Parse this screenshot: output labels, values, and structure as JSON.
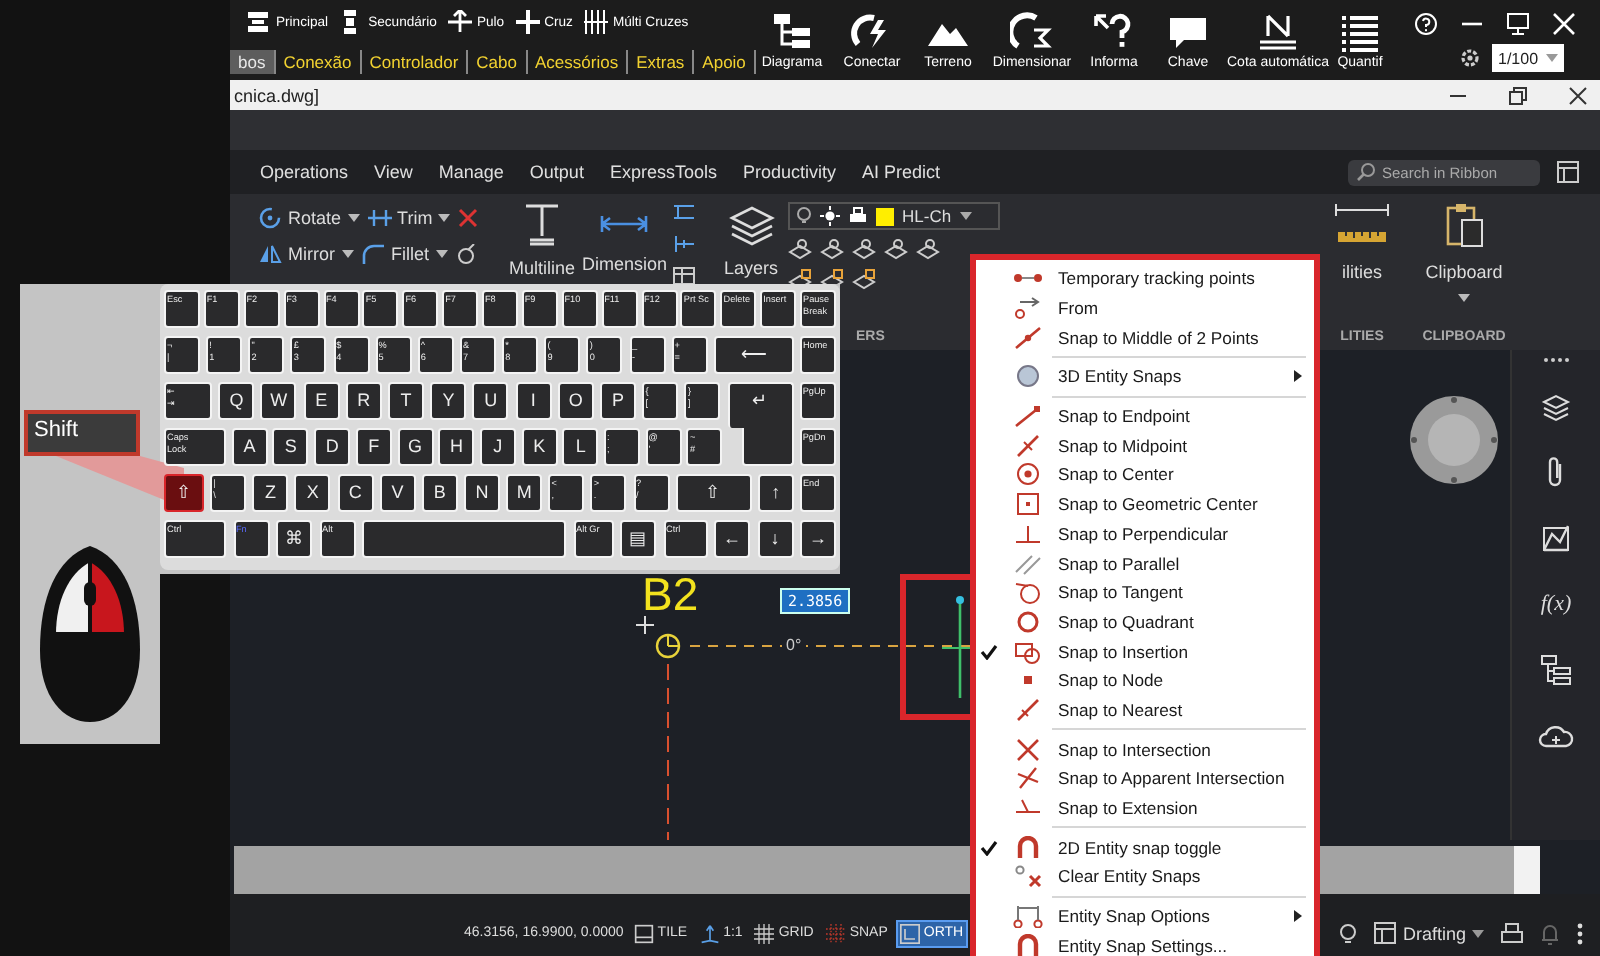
{
  "toolbar": {
    "buttons": [
      {
        "label": "Principal"
      },
      {
        "label": "Secundário"
      },
      {
        "label": "Pulo"
      },
      {
        "label": "Cruz"
      },
      {
        "label": "Múlti Cruzes"
      }
    ],
    "tabs": [
      {
        "label": "bos",
        "selected": true
      },
      {
        "label": "Conexão",
        "selected": false
      },
      {
        "label": "Controlador",
        "selected": false
      },
      {
        "label": "Cabo",
        "selected": false
      },
      {
        "label": "Acessórios",
        "selected": false
      },
      {
        "label": "Extras",
        "selected": false
      },
      {
        "label": "Apoio",
        "selected": false
      }
    ],
    "big_buttons": [
      {
        "label": "Diagrama"
      },
      {
        "label": "Conectar"
      },
      {
        "label": "Terreno"
      },
      {
        "label": "Dimensionar"
      },
      {
        "label": "Informa"
      },
      {
        "label": "Chave"
      },
      {
        "label": "Cota automática"
      },
      {
        "label": "Quantif"
      }
    ],
    "scale": {
      "value": "1/100"
    }
  },
  "document": {
    "title": "cnica.dwg]"
  },
  "ribbon": {
    "tabs": [
      {
        "label": "Operations",
        "selected": false
      },
      {
        "label": "View",
        "selected": false
      },
      {
        "label": "Manage",
        "selected": false
      },
      {
        "label": "Output",
        "selected": false
      },
      {
        "label": "ExpressTools",
        "selected": false
      },
      {
        "label": "Productivity",
        "selected": false
      },
      {
        "label": "AI Predict",
        "selected": false
      }
    ],
    "search": {
      "placeholder": "Search in Ribbon"
    },
    "modify_tools": [
      {
        "label": "Rotate"
      },
      {
        "label": "Trim"
      },
      {
        "label": "Mirror"
      },
      {
        "label": "Fillet"
      }
    ],
    "large_tools": [
      {
        "label": "Multiline"
      },
      {
        "label": "Dimension"
      },
      {
        "label": "Layers"
      }
    ],
    "layer": {
      "value": "HL-Ch"
    },
    "layers_panel": "ERS",
    "utilities_tool": "ilities",
    "utilities_panel": "LITIES",
    "clipboard_tool": "Clipboard",
    "clipboard_panel": "CLIPBOARD"
  },
  "overlay": {
    "callout": "Shift",
    "keyboard": {
      "rows": [
        {
          "keys": [
            {
              "label": "Esc",
              "kind": "key",
              "pressed": false
            },
            {
              "label": "F1",
              "kind": "key",
              "pressed": false
            },
            {
              "label": "F2",
              "kind": "key",
              "pressed": false
            },
            {
              "label": "F3",
              "kind": "key",
              "pressed": false
            },
            {
              "label": "F4",
              "kind": "key",
              "pressed": false
            },
            {
              "label": "F5",
              "kind": "key",
              "pressed": false
            },
            {
              "label": "F6",
              "kind": "key",
              "pressed": false
            },
            {
              "label": "F7",
              "kind": "key",
              "pressed": false
            },
            {
              "label": "F8",
              "kind": "key",
              "pressed": false
            },
            {
              "label": "F9",
              "kind": "key",
              "pressed": false
            },
            {
              "label": "F10",
              "kind": "key",
              "pressed": false
            },
            {
              "label": "F11",
              "kind": "key",
              "pressed": false
            },
            {
              "label": "F12",
              "kind": "key",
              "pressed": false
            },
            {
              "label": "Prt Sc",
              "kind": "key",
              "pressed": false
            },
            {
              "label": "Delete",
              "kind": "key",
              "pressed": false
            },
            {
              "label": "Insert",
              "kind": "key",
              "pressed": false
            },
            {
              "label": "Pause\nBreak",
              "kind": "key",
              "pressed": false
            }
          ]
        },
        {
          "keys": [
            {
              "label": "¬\n|",
              "kind": "key",
              "pressed": false
            },
            {
              "label": "!\n1",
              "kind": "key",
              "pressed": false
            },
            {
              "label": "\"\n2",
              "kind": "key",
              "pressed": false
            },
            {
              "label": "£\n3",
              "kind": "key",
              "pressed": false
            },
            {
              "label": "$\n4",
              "kind": "key",
              "pressed": false
            },
            {
              "label": "%\n5",
              "kind": "key",
              "pressed": false
            },
            {
              "label": "^\n6",
              "kind": "key",
              "pressed": false
            },
            {
              "label": "&\n7",
              "kind": "key",
              "pressed": false
            },
            {
              "label": "*\n8",
              "kind": "key",
              "pressed": false
            },
            {
              "label": "(\n9",
              "kind": "key",
              "pressed": false
            },
            {
              "label": ")\n0",
              "kind": "key",
              "pressed": false
            },
            {
              "label": "_\n-",
              "kind": "key",
              "pressed": false
            },
            {
              "label": "+\n=",
              "kind": "key",
              "pressed": false
            },
            {
              "label": "⟵",
              "kind": "backspace",
              "pressed": false
            },
            {
              "label": "Home",
              "kind": "key",
              "pressed": false
            }
          ]
        },
        {
          "keys": [
            {
              "label": "⇤\n⇥",
              "kind": "tab",
              "pressed": false
            },
            {
              "label": "Q",
              "kind": "key",
              "pressed": false
            },
            {
              "label": "W",
              "kind": "key",
              "pressed": false
            },
            {
              "label": "E",
              "kind": "key",
              "pressed": false
            },
            {
              "label": "R",
              "kind": "key",
              "pressed": false
            },
            {
              "label": "T",
              "kind": "key",
              "pressed": false
            },
            {
              "label": "Y",
              "kind": "key",
              "pressed": false
            },
            {
              "label": "U",
              "kind": "key",
              "pressed": false
            },
            {
              "label": "I",
              "kind": "key",
              "pressed": false
            },
            {
              "label": "O",
              "kind": "key",
              "pressed": false
            },
            {
              "label": "P",
              "kind": "key",
              "pressed": false
            },
            {
              "label": "{\n[",
              "kind": "key",
              "pressed": false
            },
            {
              "label": "}\n]",
              "kind": "key",
              "pressed": false
            },
            {
              "label": "↵",
              "kind": "enter",
              "pressed": false
            },
            {
              "label": "PgUp",
              "kind": "key",
              "pressed": false
            }
          ]
        },
        {
          "keys": [
            {
              "label": "Caps\nLock",
              "kind": "caps",
              "pressed": false
            },
            {
              "label": "A",
              "kind": "key",
              "pressed": false
            },
            {
              "label": "S",
              "kind": "key",
              "pressed": false
            },
            {
              "label": "D",
              "kind": "key",
              "pressed": false
            },
            {
              "label": "F",
              "kind": "key",
              "pressed": false
            },
            {
              "label": "G",
              "kind": "key",
              "pressed": false
            },
            {
              "label": "H",
              "kind": "key",
              "pressed": false
            },
            {
              "label": "J",
              "kind": "key",
              "pressed": false
            },
            {
              "label": "K",
              "kind": "key",
              "pressed": false
            },
            {
              "label": "L",
              "kind": "key",
              "pressed": false
            },
            {
              "label": ":\n;",
              "kind": "key",
              "pressed": false
            },
            {
              "label": "@\n'",
              "kind": "key",
              "pressed": false
            },
            {
              "label": "~\n#",
              "kind": "key",
              "pressed": false
            },
            {
              "kind": "enter_tail",
              "pressed": false
            },
            {
              "label": "PgDn",
              "kind": "key",
              "pressed": false
            }
          ]
        },
        {
          "keys": [
            {
              "label": "⇧",
              "kind": "shift_left",
              "pressed": true
            },
            {
              "label": "|\n\\",
              "kind": "key",
              "pressed": false
            },
            {
              "label": "Z",
              "kind": "key",
              "pressed": false
            },
            {
              "label": "X",
              "kind": "key",
              "pressed": false
            },
            {
              "label": "C",
              "kind": "key",
              "pressed": false
            },
            {
              "label": "V",
              "kind": "key",
              "pressed": false
            },
            {
              "label": "B",
              "kind": "key",
              "pressed": false
            },
            {
              "label": "N",
              "kind": "key",
              "pressed": false
            },
            {
              "label": "M",
              "kind": "key",
              "pressed": false
            },
            {
              "label": "<\n,",
              "kind": "key",
              "pressed": false
            },
            {
              "label": ">\n.",
              "kind": "key",
              "pressed": false
            },
            {
              "label": "?\n/",
              "kind": "key",
              "pressed": false
            },
            {
              "label": "⇧",
              "kind": "shift_right",
              "pressed": false
            },
            {
              "label": "↑",
              "kind": "key",
              "pressed": false
            },
            {
              "label": "End",
              "kind": "key",
              "pressed": false
            }
          ]
        },
        {
          "keys": [
            {
              "label": "Ctrl",
              "kind": "ctrl_left",
              "pressed": false
            },
            {
              "label": "Fn",
              "kind": "fn",
              "pressed": false
            },
            {
              "label": "⌘",
              "kind": "key",
              "pressed": false
            },
            {
              "label": "Alt",
              "kind": "key",
              "pressed": false
            },
            {
              "kind": "space",
              "pressed": false
            },
            {
              "label": "Alt Gr",
              "kind": "altgr",
              "pressed": false
            },
            {
              "label": "▤",
              "kind": "key",
              "pressed": false
            },
            {
              "label": "Ctrl",
              "kind": "ctrl_right",
              "pressed": false
            },
            {
              "label": "←",
              "kind": "key",
              "pressed": false
            },
            {
              "label": "↓",
              "kind": "key",
              "pressed": false
            },
            {
              "label": "→",
              "kind": "key",
              "pressed": false
            }
          ]
        }
      ]
    }
  },
  "canvas": {
    "label": "B2",
    "input": {
      "value": "2.3856"
    },
    "angle": "0°"
  },
  "sidebar": {
    "function_label": "f(x)"
  },
  "context_menu": {
    "items": [
      {
        "kind": "item",
        "label": "Temporary tracking points",
        "checked": false
      },
      {
        "kind": "item",
        "label": "From",
        "checked": false
      },
      {
        "kind": "item",
        "label": "Snap to Middle of 2 Points",
        "checked": false
      },
      {
        "kind": "separator"
      },
      {
        "kind": "submenu",
        "label": "3D Entity Snaps",
        "checked": false
      },
      {
        "kind": "separator"
      },
      {
        "kind": "item",
        "label": "Snap to Endpoint",
        "checked": false
      },
      {
        "kind": "item",
        "label": "Snap to Midpoint",
        "checked": false
      },
      {
        "kind": "item",
        "label": "Snap to Center",
        "checked": false
      },
      {
        "kind": "item",
        "label": "Snap to Geometric Center",
        "checked": false
      },
      {
        "kind": "item",
        "label": "Snap to Perpendicular",
        "checked": false
      },
      {
        "kind": "item",
        "label": "Snap to Parallel",
        "checked": false
      },
      {
        "kind": "item",
        "label": "Snap to Tangent",
        "checked": false
      },
      {
        "kind": "item",
        "label": "Snap to Quadrant",
        "checked": false
      },
      {
        "kind": "item",
        "label": "Snap to Insertion",
        "checked": true
      },
      {
        "kind": "item",
        "label": "Snap to Node",
        "checked": false
      },
      {
        "kind": "item",
        "label": "Snap to Nearest",
        "checked": false
      },
      {
        "kind": "separator"
      },
      {
        "kind": "item",
        "label": "Snap to Intersection",
        "checked": false
      },
      {
        "kind": "item",
        "label": "Snap to Apparent Intersection",
        "checked": false
      },
      {
        "kind": "item",
        "label": "Snap to Extension",
        "checked": false
      },
      {
        "kind": "separator"
      },
      {
        "kind": "item",
        "label": "2D Entity snap toggle",
        "checked": true
      },
      {
        "kind": "item",
        "label": "Clear Entity Snaps",
        "checked": false
      },
      {
        "kind": "separator"
      },
      {
        "kind": "submenu",
        "label": "Entity Snap Options",
        "checked": false
      },
      {
        "kind": "item",
        "label": "Entity Snap Settings...",
        "checked": false
      }
    ]
  },
  "status_bar": {
    "coordinates": "46.3156, 16.9900, 0.0000",
    "toggles": [
      {
        "label": "TILE",
        "on": false
      },
      {
        "label": "1:1",
        "on": false
      },
      {
        "label": "GRID",
        "on": false
      },
      {
        "label": "SNAP",
        "on": false
      },
      {
        "label": "ORTH",
        "on": true
      }
    ],
    "workspace": {
      "value": "Drafting"
    }
  }
}
